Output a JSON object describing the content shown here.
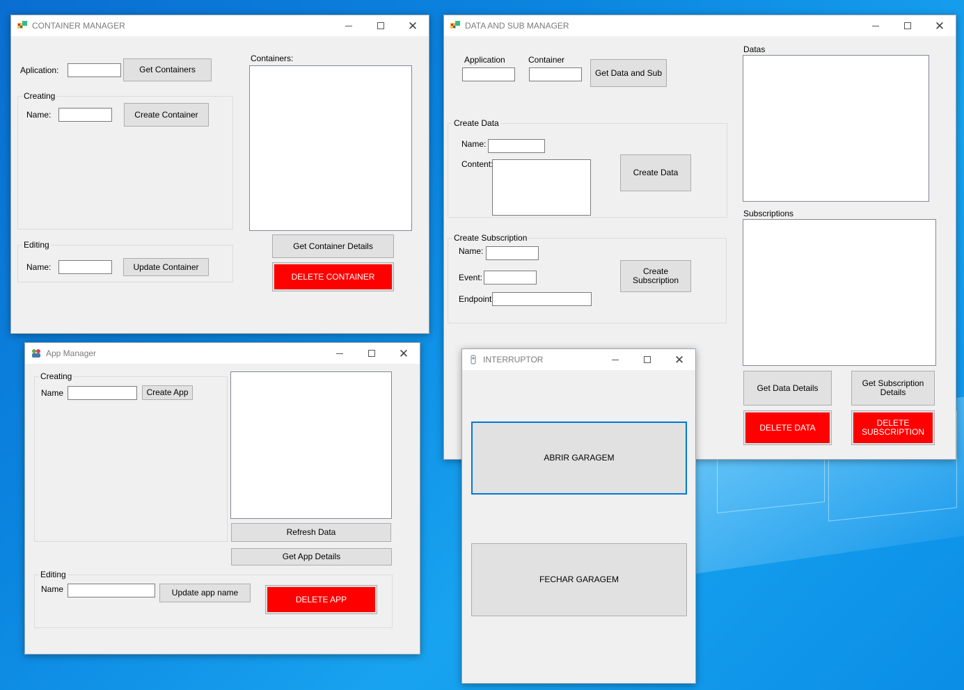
{
  "colors": {
    "desktop": "#0b86e0",
    "danger": "#ff0000",
    "button": "#e1e1e1",
    "window": "#f0f0f0"
  },
  "container_manager": {
    "title": "CONTAINER MANAGER",
    "aplication_label": "Aplication:",
    "get_containers": "Get Containers",
    "creating_group": "Creating",
    "create_name_label": "Name:",
    "create_container": "Create Container",
    "editing_group": "Editing",
    "edit_name_label": "Name:",
    "update_container": "Update Container",
    "containers_label": "Containers:",
    "get_container_details": "Get Container Details",
    "delete_container": "DELETE CONTAINER"
  },
  "data_sub_manager": {
    "title": "DATA AND SUB MANAGER",
    "application_label": "Application",
    "container_label": "Container",
    "get_data_and_sub": "Get Data and Sub",
    "create_data_group": "Create Data",
    "data_name_label": "Name:",
    "data_content_label": "Content:",
    "create_data": "Create Data",
    "create_sub_group": "Create Subscription",
    "sub_name_label": "Name:",
    "sub_event_label": "Event:",
    "sub_endpoint_label": "Endpoint",
    "create_subscription": "Create Subscription",
    "datas_label": "Datas",
    "subscriptions_label": "Subscriptions",
    "get_data_details": "Get Data Details",
    "get_subscription_details": "Get Subscription Details",
    "delete_data": "DELETE DATA",
    "delete_subscription": "DELETE SUBSCRIPTION"
  },
  "app_manager": {
    "title": "App Manager",
    "creating_group": "Creating",
    "create_name_label": "Name",
    "create_app": "Create App",
    "refresh_data": "Refresh Data",
    "get_app_details": "Get App Details",
    "editing_group": "Editing",
    "edit_name_label": "Name",
    "update_app_name": "Update app name",
    "delete_app": "DELETE APP"
  },
  "interruptor": {
    "title": "INTERRUPTOR",
    "abrir": "ABRIR GARAGEM",
    "fechar": "FECHAR GARAGEM"
  }
}
